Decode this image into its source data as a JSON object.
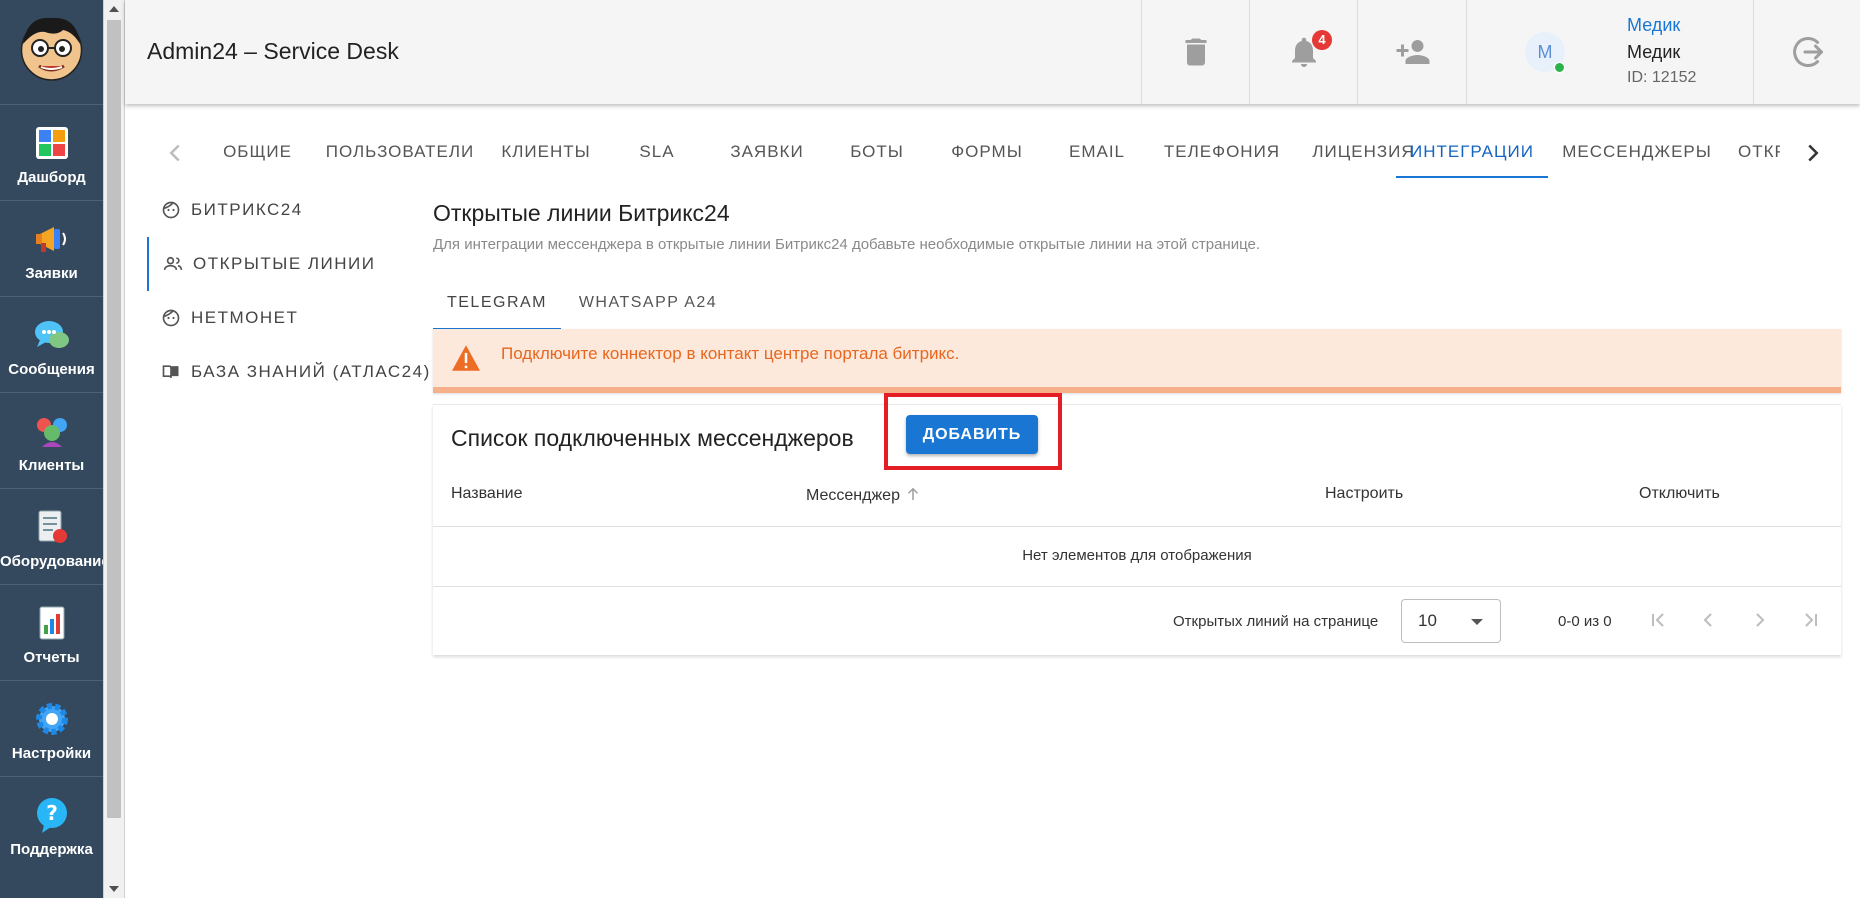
{
  "app": {
    "title": "Admin24 – Service Desk"
  },
  "sidebar": {
    "items": [
      {
        "label": "Дашборд",
        "icon": "dashboard-icon"
      },
      {
        "label": "Заявки",
        "icon": "megaphone-icon"
      },
      {
        "label": "Сообщения",
        "icon": "chat-icon"
      },
      {
        "label": "Клиенты",
        "icon": "clients-icon"
      },
      {
        "label": "Оборудование",
        "icon": "equipment-icon"
      },
      {
        "label": "Отчеты",
        "icon": "reports-icon"
      },
      {
        "label": "Настройки",
        "icon": "gear-icon"
      },
      {
        "label": "Поддержка",
        "icon": "help-icon"
      }
    ]
  },
  "header": {
    "notifications_count": "4",
    "user": {
      "avatar_letter": "M",
      "link_name": "Медик",
      "name": "Медик",
      "id": "ID: 12152"
    }
  },
  "tabs": {
    "items": [
      "ОБЩИЕ",
      "ПОЛЬЗОВАТЕЛИ",
      "КЛИЕНТЫ",
      "SLA",
      "ЗАЯВКИ",
      "БОТЫ",
      "ФОРМЫ",
      "EMAIL",
      "ТЕЛЕФОНИЯ",
      "ЛИЦЕНЗИЯ",
      "ИНТЕГРАЦИИ",
      "МЕССЕНДЖЕРЫ",
      "ОТКР"
    ],
    "active": "ИНТЕГРАЦИИ"
  },
  "subnav": {
    "items": [
      "БИТРИКС24",
      "ОТКРЫТЫЕ ЛИНИИ",
      "НЕТМОНЕТ",
      "БАЗА ЗНАНИЙ (АТЛАС24)"
    ],
    "active": "ОТКРЫТЫЕ ЛИНИИ"
  },
  "content": {
    "title": "Открытые линии Битрикс24",
    "description": "Для интеграции мессенджера в открытые линии Битрикс24 добавьте необходимые открытые линии на этой странице.",
    "inner_tabs": [
      "TELEGRAM",
      "WHATSAPP A24"
    ],
    "active_inner_tab": "TELEGRAM",
    "alert": "Подключите коннектор в контакт центре портала битрикс."
  },
  "table": {
    "title": "Список подключенных мессенджеров",
    "add_button": "ДОБАВИТЬ",
    "columns": [
      "Название",
      "Мессенджер",
      "Настроить",
      "Отключить"
    ],
    "sorted_column": "Мессенджер",
    "sort_direction": "ascending",
    "empty_message": "Нет элементов для отображения",
    "rows_per_page_label": "Открытых линий на странице",
    "rows_per_page": "10",
    "range": "0-0 из 0"
  },
  "colors": {
    "accent": "#1976d2",
    "sidebar": "#34495e",
    "alert_bg": "#fde9dc",
    "alert_text": "#e8661e",
    "highlight": "#e31e24",
    "online": "#2bb34b",
    "badge": "#e53935"
  }
}
